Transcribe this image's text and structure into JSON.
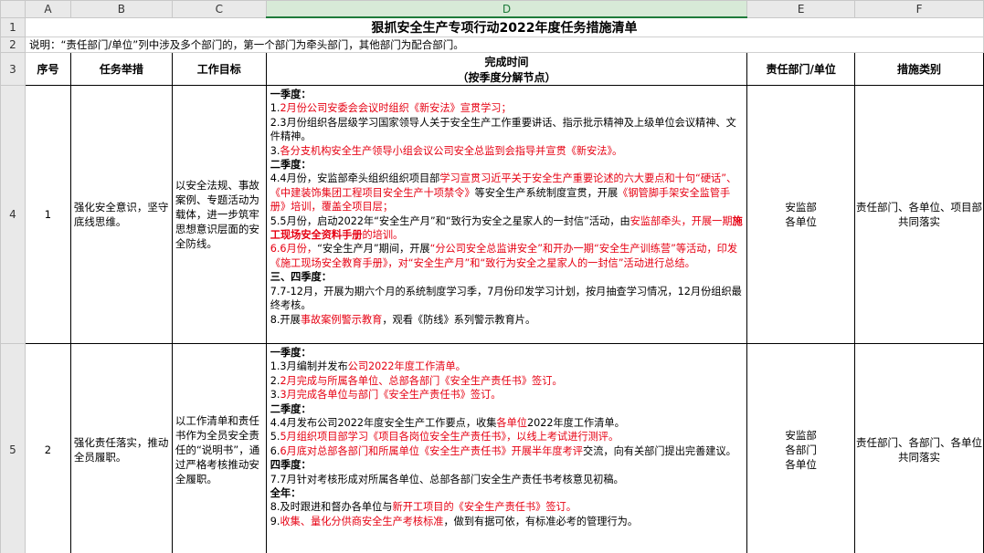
{
  "columns": [
    "A",
    "B",
    "C",
    "D",
    "E",
    "F"
  ],
  "row_numbers": [
    "1",
    "2",
    "3",
    "4",
    "5"
  ],
  "title": "狠抓安全生产专项行动2022年度任务措施清单",
  "note": "说明：“责任部门/单位”列中涉及多个部门的，第一个部门为牵头部门，其他部门为配合部门。",
  "headers": {
    "seq": "序号",
    "measure": "任务举措",
    "goal": "工作目标",
    "time_line1": "完成时间",
    "time_line2": "（按季度分解节点）",
    "dept": "责任部门/单位",
    "category": "措施类别"
  },
  "rows": [
    {
      "seq": "1",
      "measure": "强化安全意识，坚守底线思维。",
      "goal": "以安全法规、事故案例、专题活动为载体，进一步筑牢思想意识层面的安全防线。",
      "dept": "安监部\n各单位",
      "category": "责任部门、各单位、项目部共同落实",
      "plan": [
        [
          {
            "t": "一季度：",
            "s": "q"
          }
        ],
        [
          {
            "t": "1.",
            "s": ""
          },
          {
            "t": "2月份公司安委会会议时组织《新安法》宣贯学习；",
            "s": "red"
          }
        ],
        [
          {
            "t": "2.3月份组织各层级学习国家领导人关于安全生产工作重要讲话、指示批示精神及上级单位会议精神、文件精神。",
            "s": ""
          }
        ],
        [
          {
            "t": "3.",
            "s": ""
          },
          {
            "t": "各分支机构安全生产领导小组会议公司安全总监到会指导并宣贯《新安法》。",
            "s": "red"
          }
        ],
        [
          {
            "t": "二季度：",
            "s": "q"
          }
        ],
        [
          {
            "t": "4.4月份，安监部牵头组织组织项目部",
            "s": ""
          },
          {
            "t": "学习宣贯习近平关于安全生产重要论述的六大要点和十句“硬话”、《中建装饰集团工程项目安全生产十项禁令》",
            "s": "red"
          },
          {
            "t": "等安全生产系统制度宣贯，开展",
            "s": ""
          },
          {
            "t": "《钢管脚手架安全监管手册》培训，覆盖全项目层；",
            "s": "red"
          }
        ],
        [
          {
            "t": "5.5月份，启动2022年“安全生产月”和“致行为安全之星家人的一封信”活动，由",
            "s": ""
          },
          {
            "t": "安监部牵头，开展一期",
            "s": "red"
          },
          {
            "t": "施工现场安全资料手册",
            "s": "redb"
          },
          {
            "t": "的培训。",
            "s": "red"
          }
        ],
        [
          {
            "t": "6.6月份，",
            "s": "red"
          },
          {
            "t": "“安全生产月”期间，开展",
            "s": ""
          },
          {
            "t": "“分公司安全总监讲安全”和开办一期“安全生产训练营”等活动，",
            "s": "red"
          },
          {
            "t": "印发《施工现场安全教育手册》，对“安全生产月”和“致行为安全之星家人的一封信”活动进行总结。",
            "s": "red"
          }
        ],
        [
          {
            "t": "三、四季度：",
            "s": "q"
          }
        ],
        [
          {
            "t": "7.7-12月，开展为期六个月的系统制度学习季，7月份印发学习计划，按月抽查学习情况，12月份组织最终考核。",
            "s": ""
          }
        ],
        [
          {
            "t": "8.开展",
            "s": ""
          },
          {
            "t": "事故案例警示教育",
            "s": "red"
          },
          {
            "t": "，观看《防线》系列警示教育片。",
            "s": ""
          }
        ]
      ]
    },
    {
      "seq": "2",
      "measure": "强化责任落实，推动全员履职。",
      "goal": "以工作清单和责任书作为全员安全责任的“说明书”，通过严格考核推动安全履职。",
      "dept": "安监部\n各部门\n各单位",
      "category": "责任部门、各部门、各单位共同落实",
      "plan": [
        [
          {
            "t": "一季度：",
            "s": "q"
          }
        ],
        [
          {
            "t": "1.3月编制并发布",
            "s": ""
          },
          {
            "t": "公司2022年度工作清单。",
            "s": "red"
          }
        ],
        [
          {
            "t": "2.",
            "s": ""
          },
          {
            "t": "2月完成与所属各单位、总部各部门《安全生产责任书》签订。",
            "s": "red"
          }
        ],
        [
          {
            "t": "3.",
            "s": ""
          },
          {
            "t": "3月完成各单位与部门《安全生产责任书》签订。",
            "s": "red"
          }
        ],
        [
          {
            "t": "二季度：",
            "s": "q"
          }
        ],
        [
          {
            "t": "4.4月发布公司2022年度安全生产工作要点，收集",
            "s": ""
          },
          {
            "t": "各单位",
            "s": "red"
          },
          {
            "t": "2022年度工作清单。",
            "s": ""
          }
        ],
        [
          {
            "t": "5.",
            "s": ""
          },
          {
            "t": "5月组织项目部学习《项目各岗位安全生产责任书》，以线上考试进行测评。",
            "s": "red"
          }
        ],
        [
          {
            "t": "6.",
            "s": ""
          },
          {
            "t": "6月底对总部各部门和所属单位《安全生产责任书》开展半年度考评",
            "s": "red"
          },
          {
            "t": "交流，向有关部门提出完善建议。",
            "s": ""
          }
        ],
        [
          {
            "t": "四季度：",
            "s": "q"
          }
        ],
        [
          {
            "t": "7.7月针对考核形成对所属各单位、总部各部门安全生产责任书考核意见初稿。",
            "s": ""
          }
        ],
        [
          {
            "t": "全年：",
            "s": "q"
          }
        ],
        [
          {
            "t": "8.及时跟进和督办各单位与",
            "s": ""
          },
          {
            "t": "新开工项目的《安全生产责任书》签订。",
            "s": "red"
          }
        ],
        [
          {
            "t": "9.",
            "s": ""
          },
          {
            "t": "收集、量化分供商安全生产考核标准",
            "s": "red"
          },
          {
            "t": "，做到有据可依，有标准必考的管理行为。",
            "s": ""
          }
        ]
      ]
    }
  ]
}
